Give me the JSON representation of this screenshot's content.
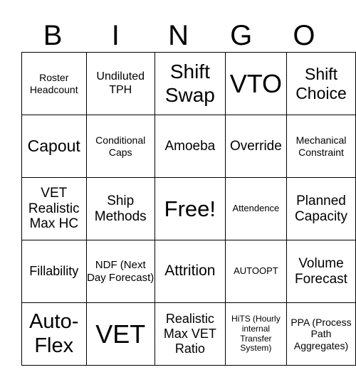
{
  "header": [
    "B",
    "I",
    "N",
    "G",
    "O"
  ],
  "cells": [
    [
      "Roster Headcount",
      "Undiluted TPH",
      "Shift Swap",
      "VTO",
      "Shift Choice"
    ],
    [
      "Capout",
      "Conditional Caps",
      "Amoeba",
      "Override",
      "Mechanical Constraint"
    ],
    [
      "VET Realistic Max HC",
      "Ship Methods",
      "Free!",
      "Attendence",
      "Planned Capacity"
    ],
    [
      "Fillability",
      "NDF (Next Day Forecast)",
      "Attrition",
      "AUTOOPT",
      "Volume Forecast"
    ],
    [
      "Auto-Flex",
      "VET",
      "Realistic Max VET Ratio",
      "HiTS (Hourly internal Transfer System)",
      "PPA (Process Path Aggregates)"
    ]
  ]
}
